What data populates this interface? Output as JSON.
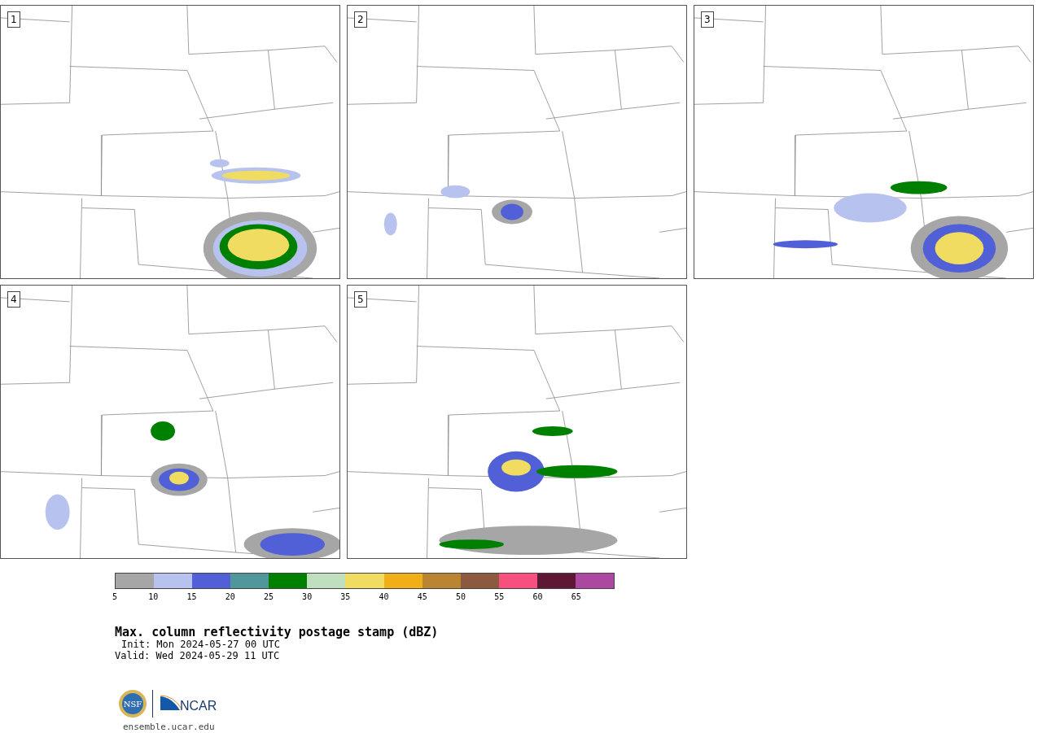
{
  "panels": [
    {
      "label": "1"
    },
    {
      "label": "2"
    },
    {
      "label": "3"
    },
    {
      "label": "4"
    },
    {
      "label": "5"
    }
  ],
  "colorbar": {
    "segments": [
      {
        "color": "#a6a6a6"
      },
      {
        "color": "#b7c3ee"
      },
      {
        "color": "#5160d6"
      },
      {
        "color": "#50979b"
      },
      {
        "color": "#008000"
      },
      {
        "color": "#bfdfbf"
      },
      {
        "color": "#f0dc60"
      },
      {
        "color": "#f0ae18"
      },
      {
        "color": "#bb8432"
      },
      {
        "color": "#8b5a3f"
      },
      {
        "color": "#f7507f"
      },
      {
        "color": "#5e1735"
      },
      {
        "color": "#ad48a2"
      }
    ],
    "ticks": [
      "5",
      "10",
      "15",
      "20",
      "25",
      "30",
      "35",
      "40",
      "45",
      "50",
      "55",
      "60",
      "65"
    ]
  },
  "title": "Max. column reflectivity postage stamp (dBZ)",
  "init": "Init: Mon 2024-05-27 00 UTC",
  "valid": "Valid: Wed 2024-05-29 11 UTC",
  "logos": {
    "seal_text": "NSF",
    "wordmark": "NCAR"
  },
  "footer": "ensemble.ucar.edu"
}
